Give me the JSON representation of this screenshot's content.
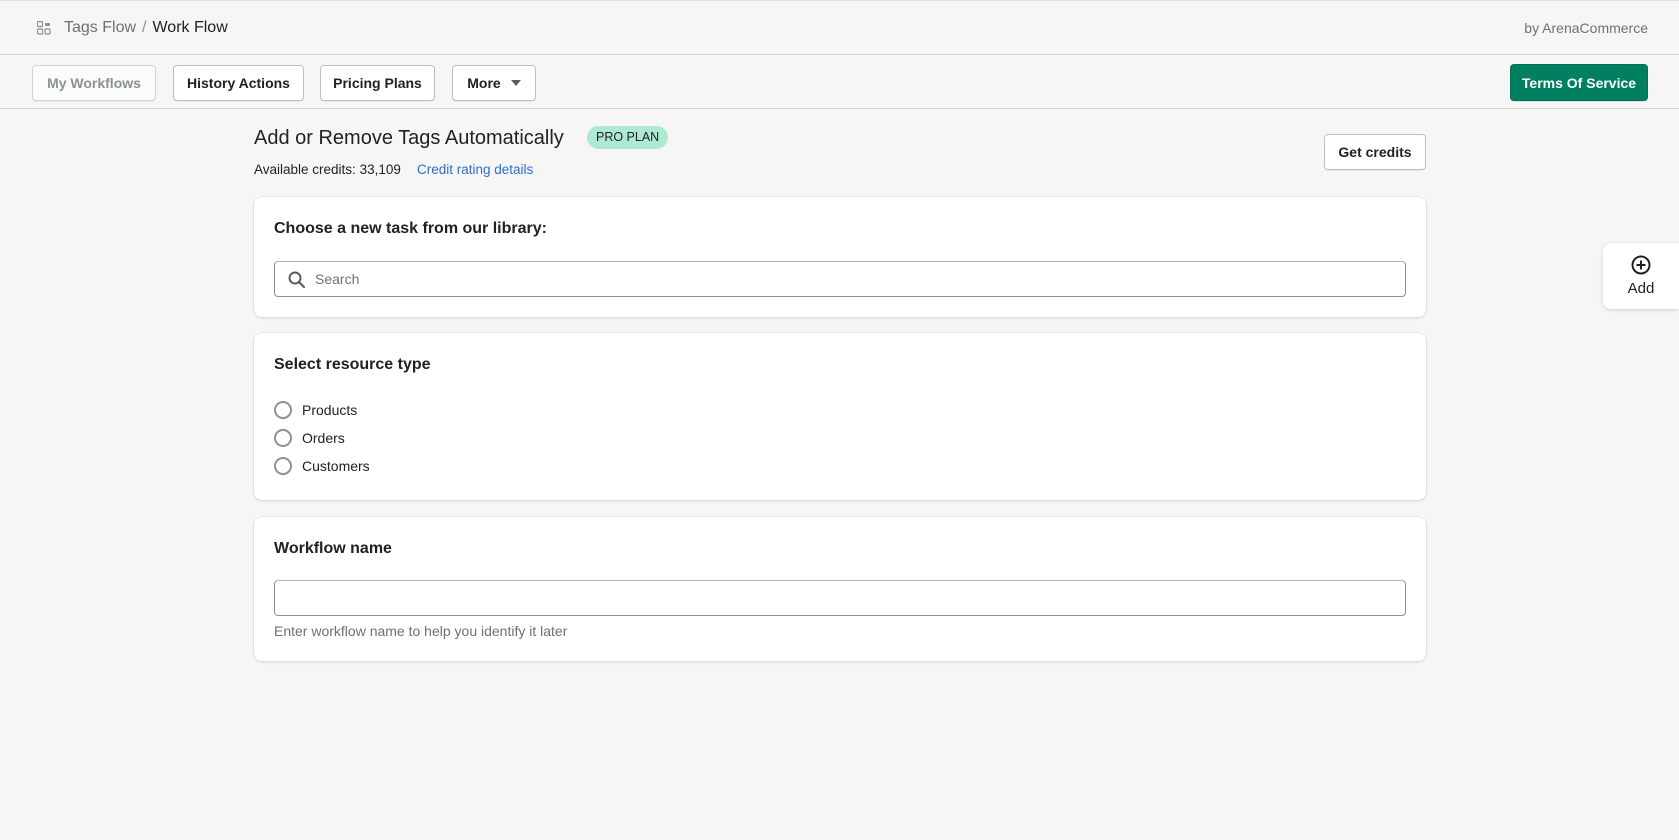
{
  "header": {
    "app_name": "Tags Flow",
    "separator": "/",
    "page_name": "Work Flow",
    "vendor": "by ArenaCommerce"
  },
  "nav": {
    "buttons": [
      {
        "label": "My Workflows",
        "disabled": true
      },
      {
        "label": "History Actions"
      },
      {
        "label": "Pricing Plans"
      },
      {
        "label": "More"
      }
    ],
    "tos_label": "Terms Of Service",
    "tos_color": "#008060"
  },
  "page": {
    "title": "Add or Remove Tags Automatically",
    "plan_badge": "PRO PLAN",
    "credits_label": "Available credits:",
    "credits_value": "33,109",
    "credit_link": "Credit rating details",
    "get_credits_label": "Get credits"
  },
  "task_library": {
    "heading": "Choose a new task from our library:",
    "search_placeholder": "Search"
  },
  "resource_type": {
    "heading": "Select resource type",
    "options": [
      "Products",
      "Orders",
      "Customers"
    ]
  },
  "workflow_name": {
    "heading": "Workflow name",
    "value": "",
    "help_text": "Enter workflow name to help you identify it later"
  },
  "add_widget": {
    "label": "Add"
  },
  "colors": {
    "primary": "#008060",
    "badge_bg": "#aee9d1",
    "link": "#2c6ecb"
  }
}
